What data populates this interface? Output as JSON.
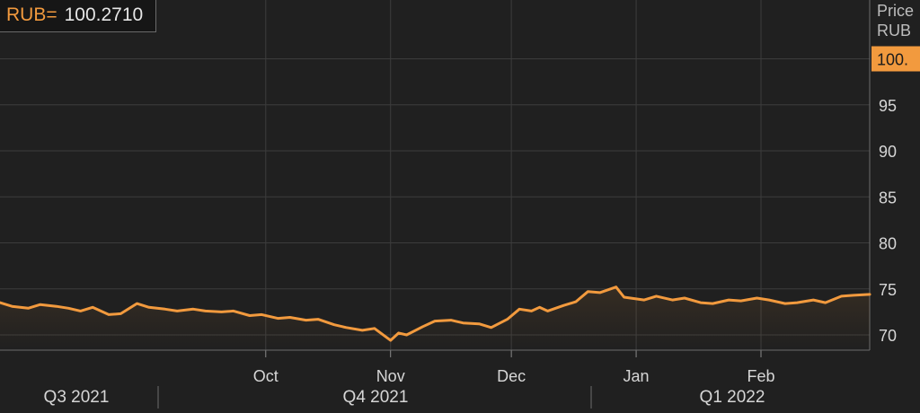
{
  "ticker": {
    "symbol": "RUB=",
    "value": "100.2710"
  },
  "colors": {
    "line": "#f29a3e",
    "grid": "#3c3c3c",
    "background": "#202020",
    "badge": "#f29a3e"
  },
  "chart_data": {
    "type": "line",
    "title": "",
    "ylabel": "Price\nRUB",
    "ylim": [
      68.5,
      102
    ],
    "yticks": [
      70,
      75,
      80,
      85,
      90,
      95
    ],
    "xlim": [
      "2021-07-27",
      "2022-02-28"
    ],
    "month_ticks": [
      {
        "date": "2021-10-01",
        "label": "Oct"
      },
      {
        "date": "2021-11-01",
        "label": "Nov"
      },
      {
        "date": "2021-12-01",
        "label": "Dec"
      },
      {
        "date": "2022-01-01",
        "label": "Jan"
      },
      {
        "date": "2022-02-01",
        "label": "Feb"
      }
    ],
    "quarter_labels": [
      "Q3 2021",
      "Q4 2021",
      "Q1 2022"
    ],
    "last_value_badge": "100.",
    "series": [
      {
        "points": [
          [
            "2021-07-27",
            73.5
          ],
          [
            "2021-07-30",
            73.1
          ],
          [
            "2021-08-03",
            72.9
          ],
          [
            "2021-08-06",
            73.3
          ],
          [
            "2021-08-10",
            73.1
          ],
          [
            "2021-08-13",
            72.9
          ],
          [
            "2021-08-16",
            72.6
          ],
          [
            "2021-08-19",
            73.0
          ],
          [
            "2021-08-23",
            72.2
          ],
          [
            "2021-08-26",
            72.3
          ],
          [
            "2021-08-30",
            73.4
          ],
          [
            "2021-09-02",
            73.0
          ],
          [
            "2021-09-06",
            72.8
          ],
          [
            "2021-09-09",
            72.6
          ],
          [
            "2021-09-13",
            72.8
          ],
          [
            "2021-09-16",
            72.6
          ],
          [
            "2021-09-20",
            72.5
          ],
          [
            "2021-09-23",
            72.6
          ],
          [
            "2021-09-27",
            72.1
          ],
          [
            "2021-09-30",
            72.2
          ],
          [
            "2021-10-04",
            71.8
          ],
          [
            "2021-10-07",
            71.9
          ],
          [
            "2021-10-11",
            71.6
          ],
          [
            "2021-10-14",
            71.7
          ],
          [
            "2021-10-18",
            71.1
          ],
          [
            "2021-10-21",
            70.8
          ],
          [
            "2021-10-25",
            70.5
          ],
          [
            "2021-10-28",
            70.7
          ],
          [
            "2021-11-01",
            69.4
          ],
          [
            "2021-11-03",
            70.2
          ],
          [
            "2021-11-05",
            70.0
          ],
          [
            "2021-11-09",
            70.9
          ],
          [
            "2021-11-12",
            71.5
          ],
          [
            "2021-11-16",
            71.6
          ],
          [
            "2021-11-19",
            71.3
          ],
          [
            "2021-11-23",
            71.2
          ],
          [
            "2021-11-26",
            70.8
          ],
          [
            "2021-11-30",
            71.7
          ],
          [
            "2021-12-03",
            72.8
          ],
          [
            "2021-12-06",
            72.6
          ],
          [
            "2021-12-08",
            73.0
          ],
          [
            "2021-12-10",
            72.6
          ],
          [
            "2021-12-14",
            73.2
          ],
          [
            "2021-12-17",
            73.6
          ],
          [
            "2021-12-20",
            74.7
          ],
          [
            "2021-12-23",
            74.6
          ],
          [
            "2021-12-27",
            75.2
          ],
          [
            "2021-12-29",
            74.1
          ],
          [
            "2022-01-03",
            73.8
          ],
          [
            "2022-01-06",
            74.2
          ],
          [
            "2022-01-10",
            73.8
          ],
          [
            "2022-01-13",
            74.0
          ],
          [
            "2022-01-17",
            73.5
          ],
          [
            "2022-01-20",
            73.4
          ],
          [
            "2022-01-24",
            73.8
          ],
          [
            "2022-01-27",
            73.7
          ],
          [
            "2022-01-31",
            74.0
          ],
          [
            "2022-02-03",
            73.8
          ],
          [
            "2022-02-07",
            73.4
          ],
          [
            "2022-02-10",
            73.5
          ],
          [
            "2022-02-14",
            73.8
          ],
          [
            "2022-02-17",
            73.5
          ],
          [
            "2022-02-21",
            74.2
          ],
          [
            "2022-02-24",
            74.3
          ],
          [
            "2022-02-28",
            74.4
          ]
        ],
        "shape_note_removed": ""
      }
    ]
  }
}
